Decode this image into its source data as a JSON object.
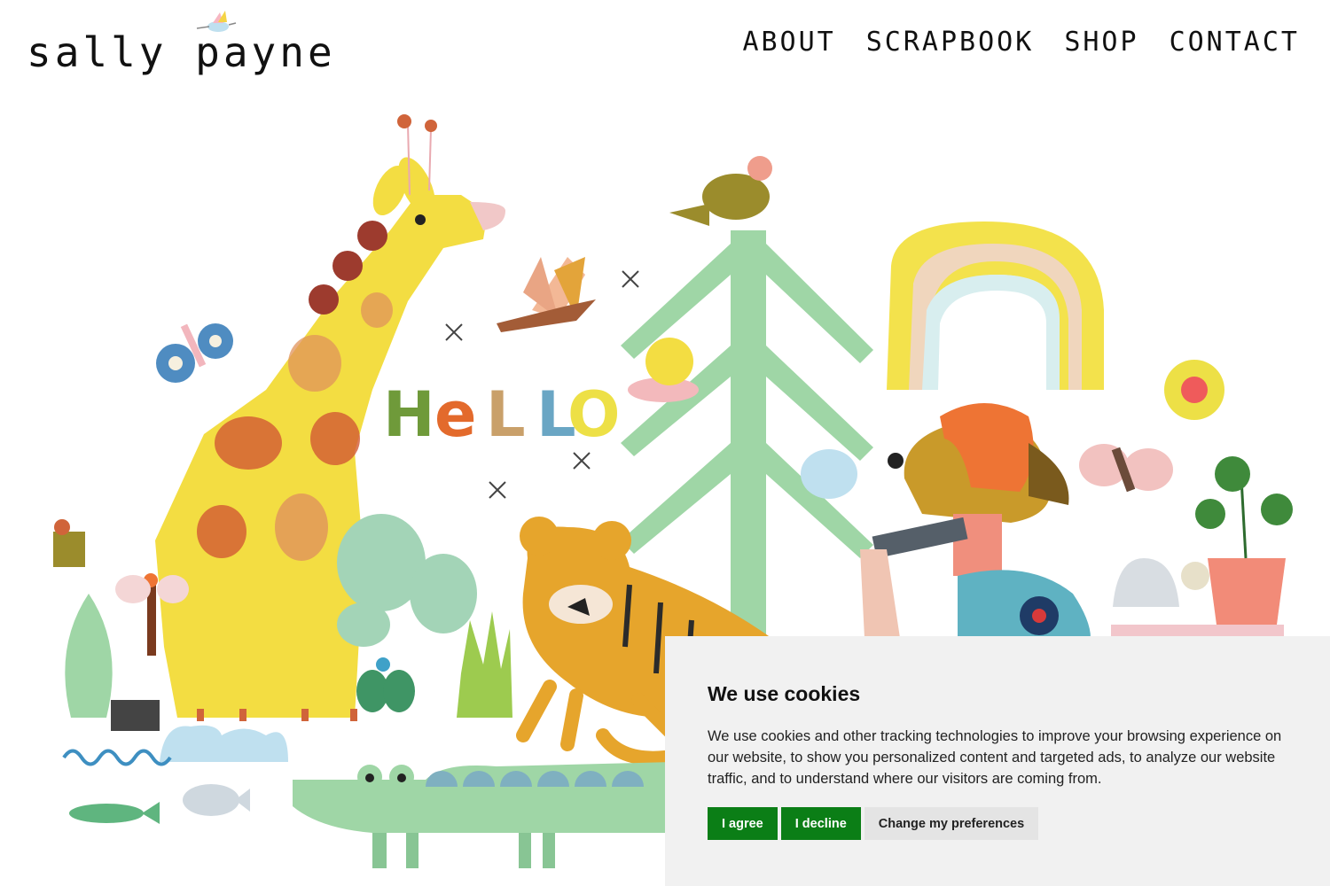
{
  "logo": {
    "text": "sally payne"
  },
  "nav": {
    "items": [
      "ABOUT",
      "SCRAPBOOK",
      "SHOP",
      "CONTACT"
    ]
  },
  "hero": {
    "greeting": [
      "H",
      "e",
      "L",
      "L",
      "O"
    ],
    "greeting_colors": [
      "#6f9a3a",
      "#e36a2c",
      "#c9a06a",
      "#6aa6c4",
      "#ede046"
    ]
  },
  "cookie": {
    "title": "We use cookies",
    "body": "We use cookies and other tracking technologies to improve your browsing experience on our website, to show you personalized content and targeted ads, to analyze our website traffic, and to understand where our visitors are coming from.",
    "agree_label": "I agree",
    "decline_label": "I decline",
    "prefs_label": "Change my preferences"
  },
  "colors": {
    "accept_button": "#0b7e16",
    "banner_background": "#f1f1f1"
  }
}
